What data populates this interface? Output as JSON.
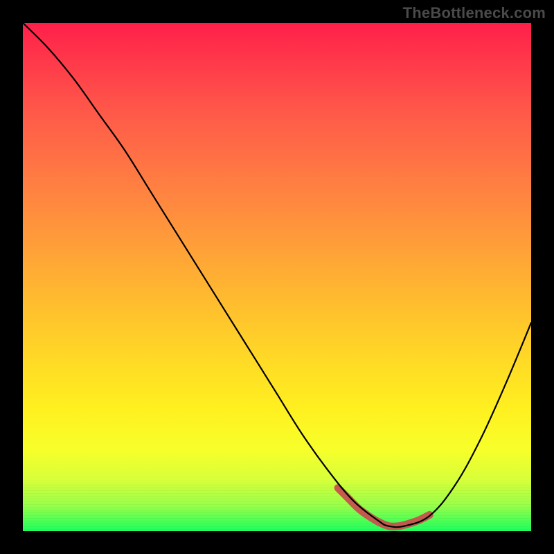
{
  "watermark": "TheBottleneck.com",
  "colors": {
    "frame": "#000000",
    "curve": "#000000",
    "trough": "#c6524e"
  },
  "chart_data": {
    "type": "line",
    "title": "",
    "xlabel": "",
    "ylabel": "",
    "xlim": [
      0,
      100
    ],
    "ylim": [
      0,
      100
    ],
    "grid": false,
    "legend": false,
    "x": [
      0,
      5,
      10,
      15,
      20,
      25,
      30,
      35,
      40,
      45,
      50,
      55,
      60,
      65,
      70,
      72,
      75,
      80,
      85,
      90,
      95,
      100
    ],
    "values": [
      100,
      95,
      89,
      82,
      75,
      67,
      59,
      51,
      43,
      35,
      27,
      19,
      12,
      6,
      2,
      1,
      1,
      3,
      9,
      18,
      29,
      41
    ],
    "annotations": [
      {
        "type": "segment_highlight",
        "x_start": 62,
        "x_end": 80,
        "note": "optimal band (trough highlight)"
      }
    ],
    "x_optimal": [
      62,
      64,
      66,
      68,
      70,
      72,
      74,
      76,
      78,
      80
    ],
    "y_optimal": [
      8.5,
      6.5,
      4.5,
      3,
      1.8,
      1,
      1,
      1.5,
      2.2,
      3.2
    ]
  }
}
